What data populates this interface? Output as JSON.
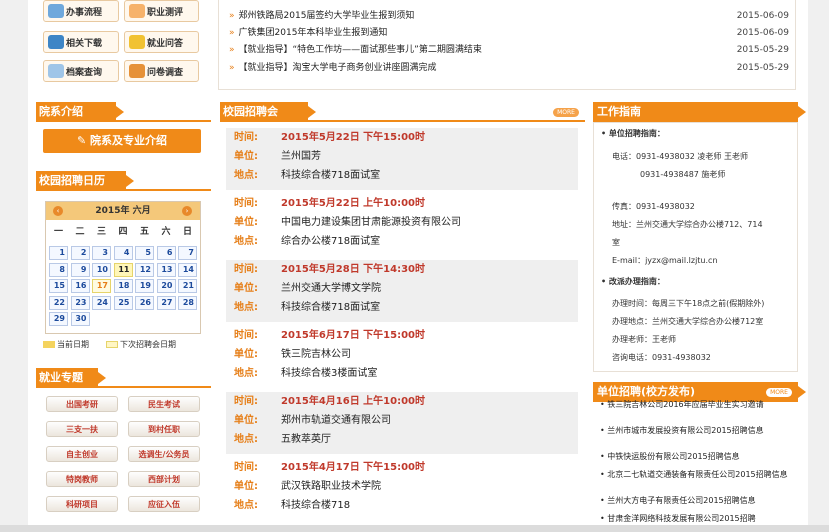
{
  "quick_links": [
    {
      "label": "办事流程",
      "icon": "folder-icon"
    },
    {
      "label": "职业测评",
      "icon": "test-icon"
    },
    {
      "label": "相关下载",
      "icon": "download-icon"
    },
    {
      "label": "就业问答",
      "icon": "qa-icon"
    },
    {
      "label": "档案查询",
      "icon": "search-icon"
    },
    {
      "label": "问卷调查",
      "icon": "survey-icon"
    }
  ],
  "news": [
    {
      "title": "郑州铁路局2015届签约大学毕业生报到须知",
      "date": "2015-06-09"
    },
    {
      "title": "广铁集团2015年本科毕业生报到通知",
      "date": "2015-06-09"
    },
    {
      "title": "【就业指导】“特色工作坊——面试那些事儿”第二期圆满结束",
      "date": "2015-05-29"
    },
    {
      "title": "【就业指导】淘宝大学电子商务创业讲座圆满完成",
      "date": "2015-05-29"
    }
  ],
  "dept": {
    "title": "院系介绍",
    "button": "院系及专业介绍"
  },
  "calendar": {
    "title": "校园招聘日历",
    "month": "2015年 六月",
    "prev": "‹",
    "next": "›",
    "weekdays": [
      "一",
      "二",
      "三",
      "四",
      "五",
      "六",
      "日"
    ],
    "weeks": [
      [
        "1",
        "2",
        "3",
        "4",
        "5",
        "6",
        "7"
      ],
      [
        "8",
        "9",
        "10",
        "11",
        "12",
        "13",
        "14"
      ],
      [
        "15",
        "16",
        "17",
        "18",
        "19",
        "20",
        "21"
      ],
      [
        "22",
        "23",
        "24",
        "25",
        "26",
        "27",
        "28"
      ],
      [
        "29",
        "30",
        "",
        "",
        "",
        "",
        ""
      ]
    ],
    "today": "11",
    "next_fair": "17",
    "legend_today": "当前日期",
    "legend_next": "下次招聘会日期"
  },
  "topics": {
    "title": "就业专题",
    "buttons": [
      "出国考研",
      "民生考试",
      "三支一扶",
      "到村任职",
      "自主创业",
      "选调生/公务员",
      "特岗教师",
      "西部计划",
      "科研项目",
      "应征入伍"
    ]
  },
  "recruit": {
    "title": "校园招聘会",
    "more": "MORE",
    "labels": {
      "time": "时间:",
      "unit": "单位:",
      "place": "地点:"
    },
    "items": [
      {
        "time": "2015年5月22日 下午15:00时",
        "unit": "兰州国芳",
        "place": "科技综合楼718面试室"
      },
      {
        "time": "2015年5月22日 上午10:00时",
        "unit": "中国电力建设集团甘肃能源投资有限公司",
        "place": "综合办公楼718面试室"
      },
      {
        "time": "2015年5月28日 下午14:30时",
        "unit": "兰州交通大学博文学院",
        "place": "科技综合楼718面试室"
      },
      {
        "time": "2015年6月17日 下午15:00时",
        "unit": "铁三院吉林公司",
        "place": "科技综合楼3楼面试室"
      },
      {
        "time": "2015年4月16日 上午10:00时",
        "unit": "郑州市轨道交通有限公司",
        "place": "五教萃英厅"
      },
      {
        "time": "2015年4月17日 下午15:00时",
        "unit": "武汉铁路职业技术学院",
        "place": "科技综合楼718"
      }
    ]
  },
  "guide": {
    "title": "工作指南",
    "unit_guide": "单位招聘指南：",
    "phone1": "电话：0931-4938032 凌老师 王老师",
    "phone2": "0931-4938487 施老师",
    "fax": "传真：0931-4938032",
    "addr1": "地址：兰州交通大学综合办公楼712、714",
    "addr2": "室",
    "email": "E-mail：jyzx@mail.lzjtu.cn",
    "reform": "改派办理指南：",
    "office_time": "办理时间：每周三下午18点之前(假期除外)",
    "office_place": "办理地点：兰州交通大学综合办公楼712室",
    "office_teacher": "办理老师：王老师",
    "consult": "咨询电话：0931-4938032"
  },
  "unit_jobs": {
    "title": "单位招聘(校方发布)",
    "more": "MORE",
    "items": [
      "铁三院吉林公司2016年应届毕业生实习邀请",
      "兰州市城市发展投资有限公司2015招聘信息",
      "中铁快运股份有限公司2015招聘信息",
      "北京二七轨道交通装备有限责任公司2015招聘信息",
      "兰州大方电子有限责任公司2015招聘信息",
      "甘肃金洋网络科技发展有限公司2015招聘"
    ]
  }
}
